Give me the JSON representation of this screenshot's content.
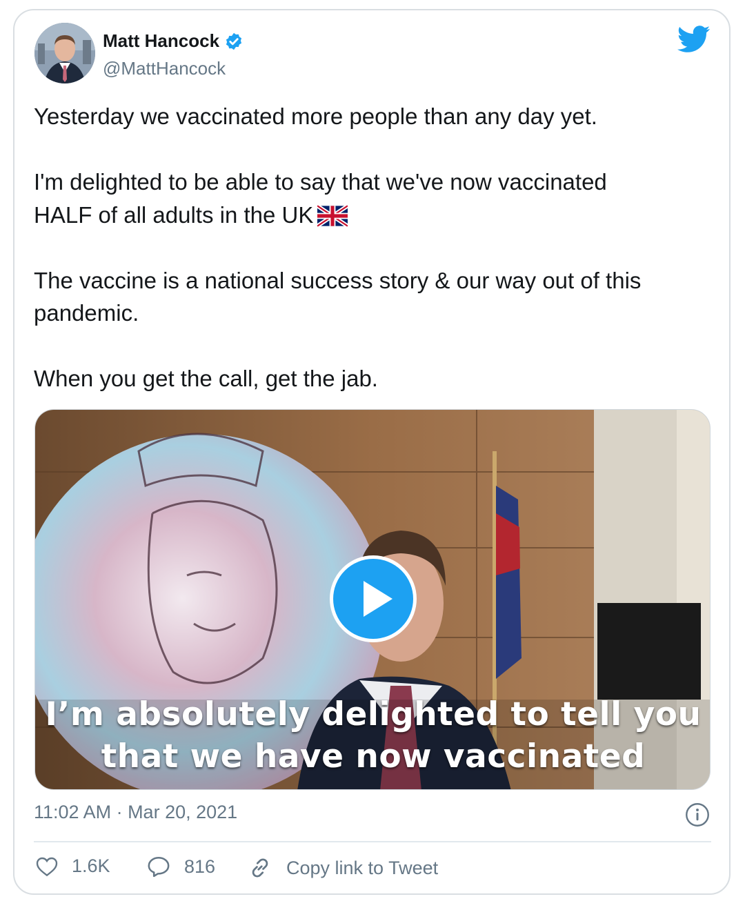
{
  "author": {
    "name": "Matt Hancock",
    "handle": "@MattHancock",
    "verified": true,
    "verified_icon": "verified-badge-icon",
    "brand_icon": "twitter-bird-icon",
    "brand_color": "#1da1f2"
  },
  "tweet": {
    "line1": "Yesterday we vaccinated more people than any day yet.",
    "line2": "I'm delighted to be able to say that we've now vaccinated",
    "line3": "HALF of all adults in the UK",
    "line3_emoji": "uk-flag-icon",
    "line4": "The vaccine is a national success story & our way out of this",
    "line5": "pandemic.",
    "line6": "When you get the call, get the jab."
  },
  "media": {
    "type": "video",
    "play_icon": "play-icon",
    "caption_line1": "I’m absolutely delighted to tell you",
    "caption_line2": "that we have now vaccinated"
  },
  "timestamp": "11:02 AM · Mar 20, 2021",
  "actions": {
    "likes": "1.6K",
    "like_icon": "heart-icon",
    "replies": "816",
    "reply_icon": "reply-bubble-icon",
    "copy_link_label": "Copy link to Tweet",
    "copy_icon": "link-icon",
    "info_icon": "info-icon"
  },
  "colors": {
    "text": "#14171a",
    "secondary": "#657786",
    "accent": "#1da1f2",
    "border": "#d9dee2"
  }
}
